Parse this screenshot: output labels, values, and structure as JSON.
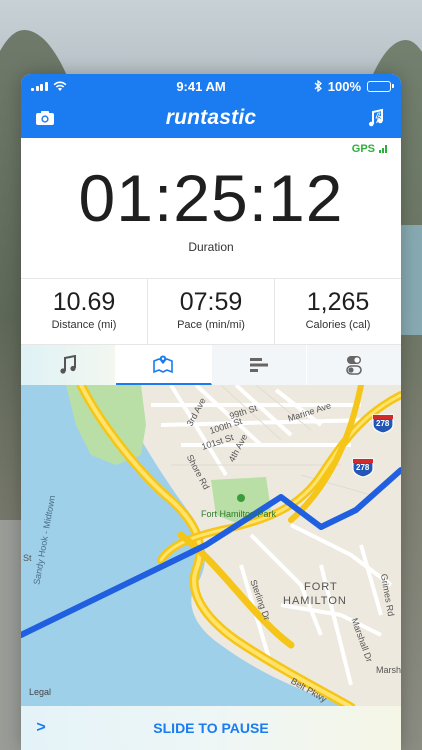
{
  "status_bar": {
    "time": "9:41 AM",
    "battery": "100%",
    "battery_level": 1.0
  },
  "app": {
    "title": "runtastic"
  },
  "gps": {
    "label": "GPS"
  },
  "duration": {
    "value": "01:25:12",
    "label": "Duration"
  },
  "stats": [
    {
      "value": "10.69",
      "label": "Distance (mi)"
    },
    {
      "value": "07:59",
      "label": "Pace (min/mi)"
    },
    {
      "value": "1,265",
      "label": "Calories (cal)"
    }
  ],
  "tabs": [
    {
      "icon": "music-note-icon"
    },
    {
      "icon": "map-icon",
      "active": true
    },
    {
      "icon": "bar-chart-icon"
    },
    {
      "icon": "toggle-settings-icon"
    }
  ],
  "map": {
    "labels": {
      "avenue_3rd": "3rd Ave",
      "street_99th": "99th St",
      "street_100th": "100th St",
      "street_101st": "101st St",
      "avenue_4th": "4th Ave",
      "marine_ave": "Marine Ave",
      "shore_rd": "Shore Rd",
      "park": "Fort Hamilton Park",
      "fort_hamilton_1": "FORT",
      "fort_hamilton_2": "HAMILTON",
      "sterling_dr": "Sterling Dr",
      "marshall_dr": "Marshall Dr",
      "grimes_rd": "Grimes Rd",
      "marsh": "Marsh",
      "belt_pkwy": "Belt Pkwy",
      "sandy_hook": "Sandy Hook - Midtown",
      "st": "St",
      "legal": "Legal",
      "shield_278_a": "278",
      "shield_278_b": "278"
    },
    "route_color": "#1f5fe0"
  },
  "slide": {
    "arrow": ">",
    "label": "SLIDE TO PAUSE"
  },
  "colors": {
    "brand_blue": "#1a7cf0",
    "gps_green": "#2fae3b"
  }
}
